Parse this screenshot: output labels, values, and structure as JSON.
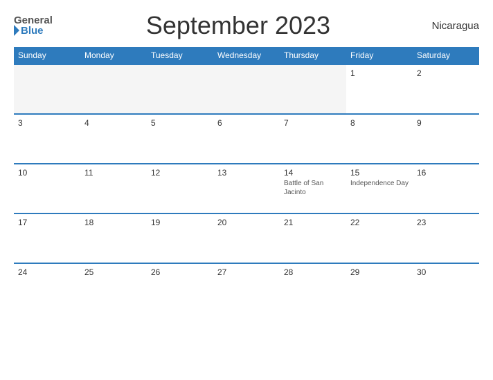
{
  "header": {
    "logo_general": "General",
    "logo_blue": "Blue",
    "title": "September 2023",
    "country": "Nicaragua"
  },
  "days_of_week": [
    "Sunday",
    "Monday",
    "Tuesday",
    "Wednesday",
    "Thursday",
    "Friday",
    "Saturday"
  ],
  "weeks": [
    [
      {
        "day": "",
        "empty": true
      },
      {
        "day": "",
        "empty": true
      },
      {
        "day": "",
        "empty": true
      },
      {
        "day": "",
        "empty": true
      },
      {
        "day": "",
        "empty": true
      },
      {
        "day": "1",
        "holiday": ""
      },
      {
        "day": "2",
        "holiday": ""
      }
    ],
    [
      {
        "day": "3",
        "holiday": ""
      },
      {
        "day": "4",
        "holiday": ""
      },
      {
        "day": "5",
        "holiday": ""
      },
      {
        "day": "6",
        "holiday": ""
      },
      {
        "day": "7",
        "holiday": ""
      },
      {
        "day": "8",
        "holiday": ""
      },
      {
        "day": "9",
        "holiday": ""
      }
    ],
    [
      {
        "day": "10",
        "holiday": ""
      },
      {
        "day": "11",
        "holiday": ""
      },
      {
        "day": "12",
        "holiday": ""
      },
      {
        "day": "13",
        "holiday": ""
      },
      {
        "day": "14",
        "holiday": "Battle of San Jacinto"
      },
      {
        "day": "15",
        "holiday": "Independence Day"
      },
      {
        "day": "16",
        "holiday": ""
      }
    ],
    [
      {
        "day": "17",
        "holiday": ""
      },
      {
        "day": "18",
        "holiday": ""
      },
      {
        "day": "19",
        "holiday": ""
      },
      {
        "day": "20",
        "holiday": ""
      },
      {
        "day": "21",
        "holiday": ""
      },
      {
        "day": "22",
        "holiday": ""
      },
      {
        "day": "23",
        "holiday": ""
      }
    ],
    [
      {
        "day": "24",
        "holiday": ""
      },
      {
        "day": "25",
        "holiday": ""
      },
      {
        "day": "26",
        "holiday": ""
      },
      {
        "day": "27",
        "holiday": ""
      },
      {
        "day": "28",
        "holiday": ""
      },
      {
        "day": "29",
        "holiday": ""
      },
      {
        "day": "30",
        "holiday": ""
      }
    ]
  ]
}
